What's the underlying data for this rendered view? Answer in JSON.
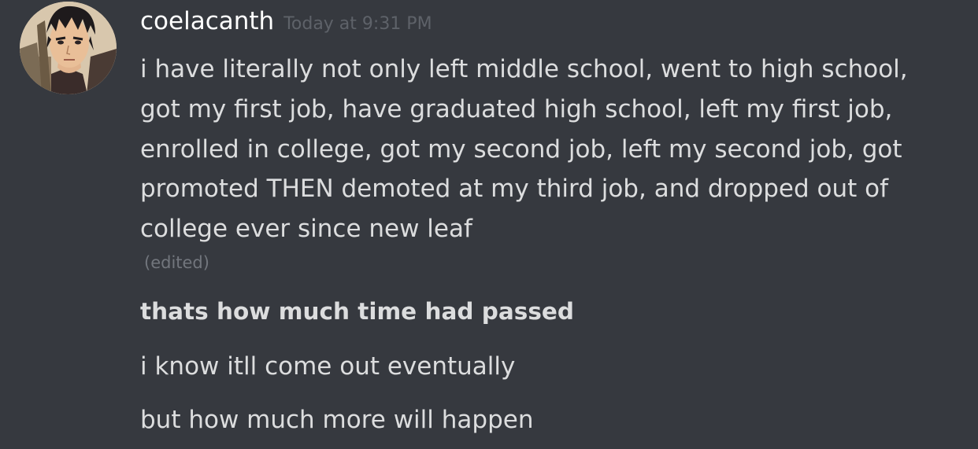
{
  "message": {
    "author": "coelacanth",
    "timestamp": "Today at 9:31 PM",
    "avatar_icon": "anime-character-avatar",
    "first_message_lines": [
      "i have literally not only left middle school, went to high school,",
      "got my first job, have graduated high school, left my first job,",
      "enrolled in college, got my second job, left my second job, got",
      "promoted THEN demoted at my third job, and dropped out of",
      "college ever since new leaf"
    ],
    "edited_label": "(edited)",
    "followups": [
      "thats how much time had passed",
      "i know itll come out eventually",
      "but how much more will happen"
    ]
  },
  "colors": {
    "background": "#36393f",
    "username": "#ffffff",
    "message_text": "#dcddde",
    "timestamp": "#5e6269",
    "edited": "#72767d"
  }
}
